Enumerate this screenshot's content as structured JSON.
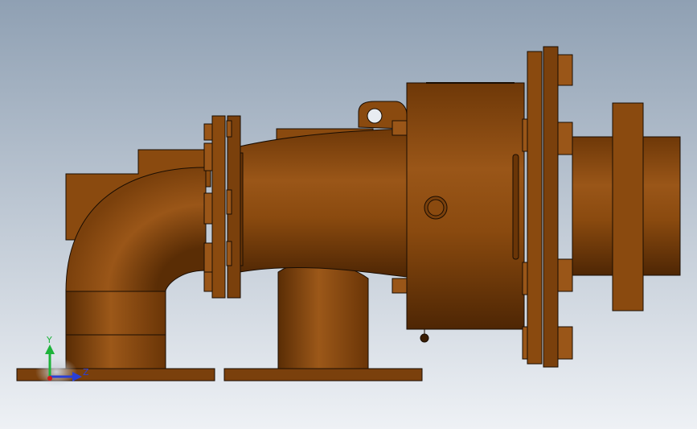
{
  "viewport": {
    "background_top": "#8fa0b3",
    "background_bottom": "#eef1f5"
  },
  "model": {
    "body_color": "#8a4a0f",
    "body_dark": "#5c2e05",
    "body_light": "#b06a24",
    "edge_color": "#1a0d02"
  },
  "triad": {
    "y_label": "Y",
    "z_label": "Z",
    "y_color": "#1db33a",
    "z_color": "#2a3fd6",
    "x_color": "#d11a1a"
  }
}
